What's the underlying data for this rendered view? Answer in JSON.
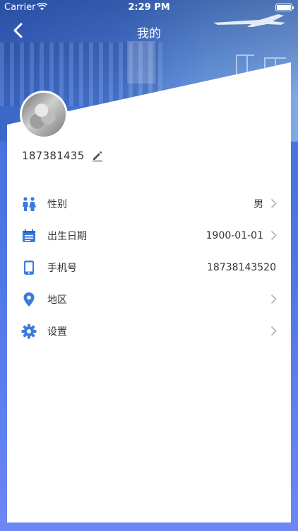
{
  "status_bar": {
    "carrier": "Carrier",
    "time": "2:29 PM"
  },
  "nav": {
    "title": "我的",
    "back_icon": "chevron-left-icon"
  },
  "profile": {
    "username": "187381435",
    "edit_icon": "pencil-icon"
  },
  "menu": {
    "items": [
      {
        "label": "性别",
        "value": "男",
        "icon": "gender-icon",
        "chevron": true
      },
      {
        "label": "出生日期",
        "value": "1900-01-01",
        "icon": "calendar-icon",
        "chevron": true
      },
      {
        "label": "手机号",
        "value": "18738143520",
        "icon": "phone-icon",
        "chevron": false
      },
      {
        "label": "地区",
        "value": "",
        "icon": "location-pin-icon",
        "chevron": true
      },
      {
        "label": "设置",
        "value": "",
        "icon": "settings-gear-icon",
        "chevron": true
      }
    ]
  },
  "colors": {
    "accent": "#3a7be0",
    "background_top": "#3f6fd6",
    "background_bottom": "#6d86f6",
    "text": "#333333",
    "chevron": "#b8b8b8"
  }
}
